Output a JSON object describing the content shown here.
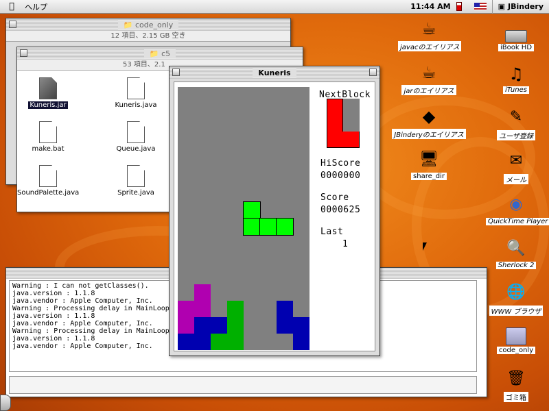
{
  "menubar": {
    "apple": "",
    "help": "ヘルプ",
    "clock": "11:44 AM",
    "app_name": "JBindery"
  },
  "win_code_only": {
    "title": "code_only",
    "info": "12 項目、2.15 GB 空き"
  },
  "win_c5": {
    "title": "c5",
    "info": "53 項目、2.1",
    "files": [
      {
        "label": "Kuneris.jar"
      },
      {
        "label": "Kuneris.java"
      },
      {
        "label": "make.bat"
      },
      {
        "label": "Queue.java"
      },
      {
        "label": "SoundPalette.java"
      },
      {
        "label": "Sprite.java"
      }
    ]
  },
  "kuneris": {
    "title": "Kuneris",
    "next_label": "NextBlock",
    "hiscore_label": "HiScore",
    "hiscore": "0000000",
    "score_label": "Score",
    "score": "0000625",
    "last_label": "Last",
    "last": "1"
  },
  "console": {
    "lines": [
      "Warning : I can not getClasses().",
      "java.version : 1.1.8",
      "java.vendor : Apple Computer, Inc.",
      "Warning : Processing delay in MainLoop",
      "java.version : 1.1.8",
      "java.vendor : Apple Computer, Inc.",
      "Warning : Processing delay in MainLoop",
      "java.version : 1.1.8",
      "java.vendor : Apple Computer, Inc."
    ]
  },
  "desktop": {
    "javac": "javacのエイリアス",
    "jar": "jarのエイリアス",
    "jbindery": "JBinderyのエイリアス",
    "share": "share_dir",
    "ibook": "iBook HD",
    "itunes": "iTunes",
    "user": "ユーザ登録",
    "mail": "メール",
    "quicktime": "QuickTime Player",
    "sherlock": "Sherlock 2",
    "www": "WWW ブラウザ",
    "code_only": "code_only",
    "trash": "ゴミ箱"
  },
  "colors": {
    "board": "#808080",
    "magenta": "#b000b0",
    "blue": "#0000b0",
    "green": "#00b000",
    "bright_green": "#00ff00",
    "red": "#ff0000"
  }
}
